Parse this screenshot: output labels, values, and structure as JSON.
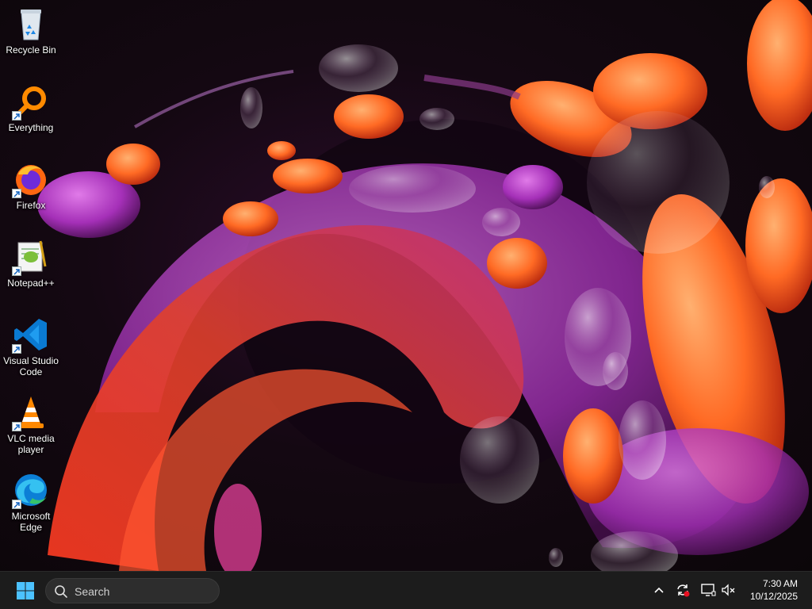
{
  "desktop": {
    "icons": [
      {
        "label": "Recycle Bin",
        "icon": "recycle-bin-icon"
      },
      {
        "label": "Everything",
        "icon": "everything-search-icon"
      },
      {
        "label": "Firefox",
        "icon": "firefox-icon"
      },
      {
        "label": "Notepad++",
        "icon": "notepad-plus-plus-icon"
      },
      {
        "label": "Visual Studio Code",
        "icon": "vscode-icon"
      },
      {
        "label": "VLC media player",
        "icon": "vlc-icon"
      },
      {
        "label": "Microsoft Edge",
        "icon": "edge-icon"
      }
    ]
  },
  "taskbar": {
    "start_icon": "windows-start-icon",
    "search_placeholder": "Search",
    "tray": {
      "chevron_icon": "show-hidden-icons-chevron-icon",
      "sync_icon": "sync-status-icon",
      "display_icon": "display-network-icon",
      "volume_icon": "volume-muted-icon"
    },
    "clock": {
      "time": "7:30 AM",
      "date": "10/12/2025"
    }
  },
  "colors": {
    "taskbar_bg": "#1c1c1c",
    "accent_blue": "#0078d4",
    "wallpaper_orange": "#ff7a2a",
    "wallpaper_magenta": "#b23ec9"
  }
}
